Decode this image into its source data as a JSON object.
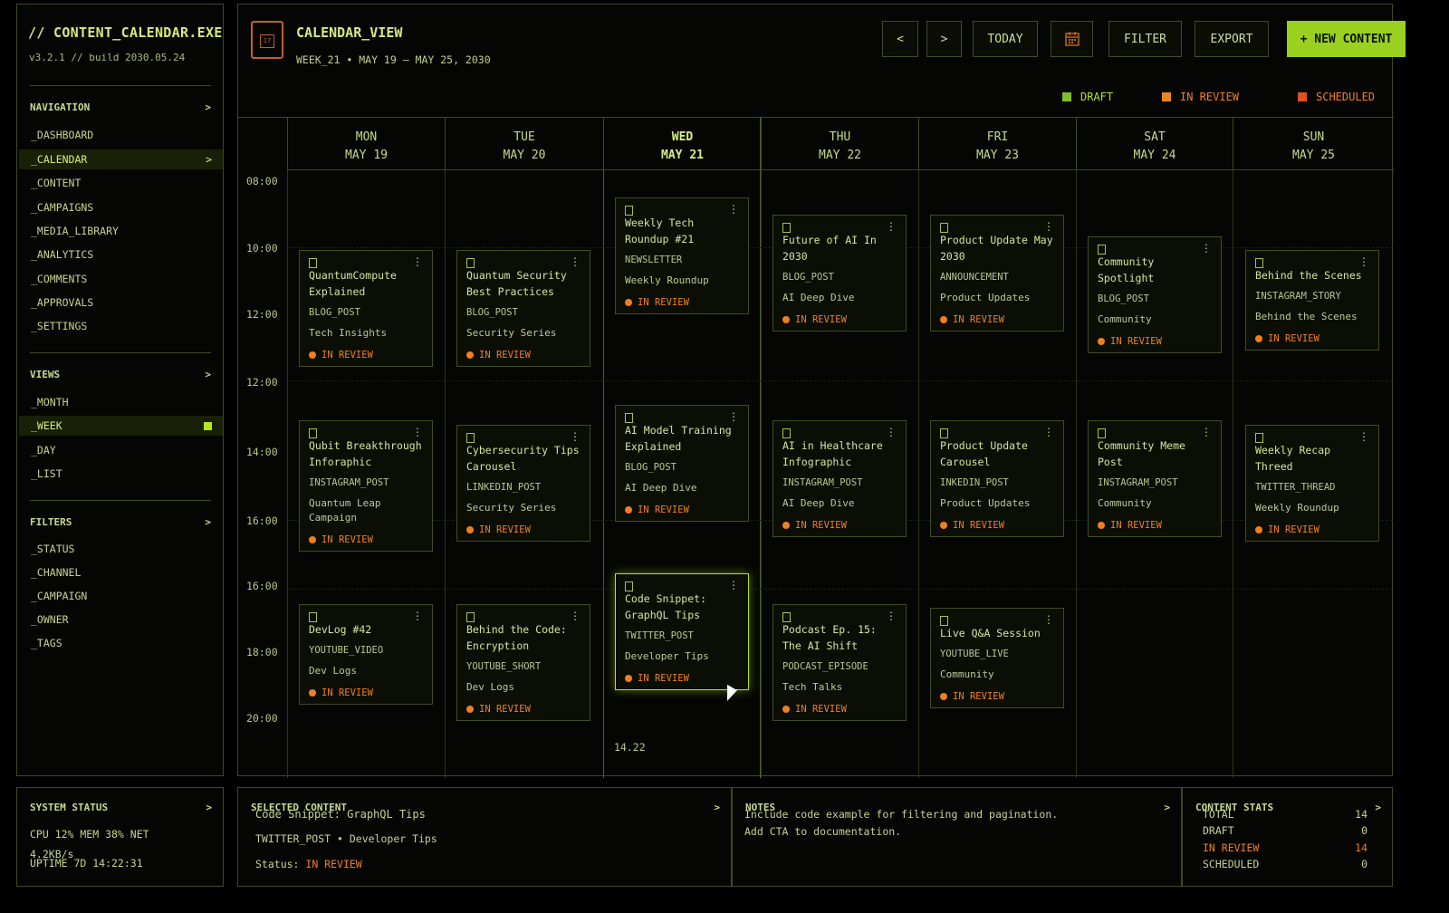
{
  "sidebar": {
    "app_title": "// CONTENT_CALENDAR.EXE",
    "version": "v3.2.1 // build 2030.05.24",
    "navigation_head": "NAVIGATION",
    "navigation": [
      "_DASHBOARD",
      "_CALENDAR",
      "_CONTENT",
      "_CAMPAIGNS",
      "_MEDIA_LIBRARY",
      "_ANALYTICS",
      "_COMMENTS",
      "_APPROVALS",
      "_SETTINGS"
    ],
    "views_head": "VIEWS",
    "views": [
      "_MONTH",
      "_WEEK",
      "_DAY",
      "_LIST"
    ],
    "filters_head": "FILTERS",
    "filters": [
      "_STATUS",
      "_CHANNEL",
      "_CAMPAIGN",
      "_OWNER",
      "_TAGS"
    ],
    "chevron": ">"
  },
  "header": {
    "title": "CALENDAR_VIEW",
    "subtitle": "WEEK_21 • MAY 19 – MAY 25, 2030",
    "prev": "<",
    "next": ">",
    "today": "TODAY",
    "filter": "FILTER",
    "export": "EXPORT",
    "new_content": "+ NEW CONTENT",
    "calendar_icon_text": "17"
  },
  "legend": [
    {
      "label": "DRAFT",
      "color": "#7fbf2a"
    },
    {
      "label": "IN REVIEW",
      "color": "#e8891f"
    },
    {
      "label": "SCHEDULED",
      "color": "#e0521d"
    }
  ],
  "days": [
    {
      "name": "MON",
      "date": "MAY 19"
    },
    {
      "name": "TUE",
      "date": "MAY 20"
    },
    {
      "name": "WED",
      "date": "MAY 21"
    },
    {
      "name": "THU",
      "date": "MAY 22"
    },
    {
      "name": "FRI",
      "date": "MAY 23"
    },
    {
      "name": "SAT",
      "date": "MAY 24"
    },
    {
      "name": "SUN",
      "date": "MAY 25"
    }
  ],
  "times": [
    "08:00",
    "10:00",
    "12:00",
    "12:00",
    "14:00",
    "16:00",
    "16:00",
    "18:00",
    "20:00"
  ],
  "current_time": "14.22",
  "cards": [
    {
      "title": "QuantumCompute Explained",
      "channel": "BLOG_POST",
      "campaign": "Tech Insights",
      "status": "IN REVIEW"
    },
    {
      "title": "Quantum Security Best Practices",
      "channel": "BLOG_POST",
      "campaign": "Security Series",
      "status": "IN REVIEW"
    },
    {
      "title": "Weekly Tech Roundup #21",
      "channel": "NEWSLETTER",
      "campaign": "Weekly Roundup",
      "status": "IN REVIEW"
    },
    {
      "title": "Future of AI In 2030",
      "channel": "BLOG_POST",
      "campaign": "AI Deep Dive",
      "status": "IN REVIEW"
    },
    {
      "title": "Product Update May 2030",
      "channel": "ANNOUNCEMENT",
      "campaign": "Product Updates",
      "status": "IN REVIEW"
    },
    {
      "title": "Community Spotlight",
      "channel": "BLOG_POST",
      "campaign": "Community",
      "status": "IN REVIEW"
    },
    {
      "title": "Behind the Scenes",
      "channel": "INSTAGRAM_STORY",
      "campaign": "Behind the Scenes",
      "status": "IN REVIEW"
    },
    {
      "title": "Qubit Breakthrough Inforaphic",
      "channel": "INSTAGRAM_POST",
      "campaign": "Quantum Leap Campaign",
      "status": "IN REVIEW"
    },
    {
      "title": "Cybersecurity Tips Carousel",
      "channel": "LINKEDIN_POST",
      "campaign": "Security Series",
      "status": "IN REVIEW"
    },
    {
      "title": "AI Model Training Explained",
      "channel": "BLOG_POST",
      "campaign": "AI Deep Dive",
      "status": "IN REVIEW"
    },
    {
      "title": "AI in Healthcare Infographic",
      "channel": "INSTAGRAM_POST",
      "campaign": "AI Deep Dive",
      "status": "IN REVIEW"
    },
    {
      "title": "Product Update Carousel",
      "channel": "INKEDIN_POST",
      "campaign": "Product Updates",
      "status": "IN REVIEW"
    },
    {
      "title": "Community Meme Post",
      "channel": "INSTAGRAM_POST",
      "campaign": "Community",
      "status": "IN REVIEW"
    },
    {
      "title": "Weekly Recap Threed",
      "channel": "TWITTER_THREAD",
      "campaign": "Weekly Roundup",
      "status": "IN REVIEW"
    },
    {
      "title": "DevLog #42",
      "channel": "YOUTUBE_VIDEO",
      "campaign": "Dev Logs",
      "status": "IN REVIEW"
    },
    {
      "title": "Behind the Code: Encryption",
      "channel": "YOUTUBE_SHORT",
      "campaign": "Dev Logs",
      "status": "IN REVIEW"
    },
    {
      "title": "Code Snippet: GraphQL Tips",
      "channel": "TWITTER_POST",
      "campaign": "Developer Tips",
      "status": "IN REVIEW"
    },
    {
      "title": "Podcast Ep. 15: The AI Shift",
      "channel": "PODCAST_EPISODE",
      "campaign": "Tech Talks",
      "status": "IN REVIEW"
    },
    {
      "title": "Live Q&A Session",
      "channel": "YOUTUBE_LIVE",
      "campaign": "Community",
      "status": "IN REVIEW"
    }
  ],
  "card_menu": "⋮",
  "system_status": {
    "head": "SYSTEM STATUS",
    "line1": "CPU 12%   MEM 38%   NET",
    "line2": "4.2KB/s",
    "uptime": "UPTIME 7D 14:22:31"
  },
  "selected": {
    "head": "SELECTED CONTENT",
    "title": "Code Snippet: GraphQL Tips",
    "meta": "TWITTER_POST • Developer Tips",
    "status_label": "Status:",
    "status_value": "IN REVIEW"
  },
  "notes": {
    "head": "NOTES",
    "line1": "Include code example for filtering and pagination.",
    "line2": "Add CTA to documentation."
  },
  "stats": {
    "head": "CONTENT STATS",
    "rows": [
      {
        "label": "TOTAL",
        "value": "14"
      },
      {
        "label": "DRAFT",
        "value": "0"
      },
      {
        "label": "IN REVIEW",
        "value": "14"
      },
      {
        "label": "SCHEDULED",
        "value": "0"
      }
    ]
  }
}
